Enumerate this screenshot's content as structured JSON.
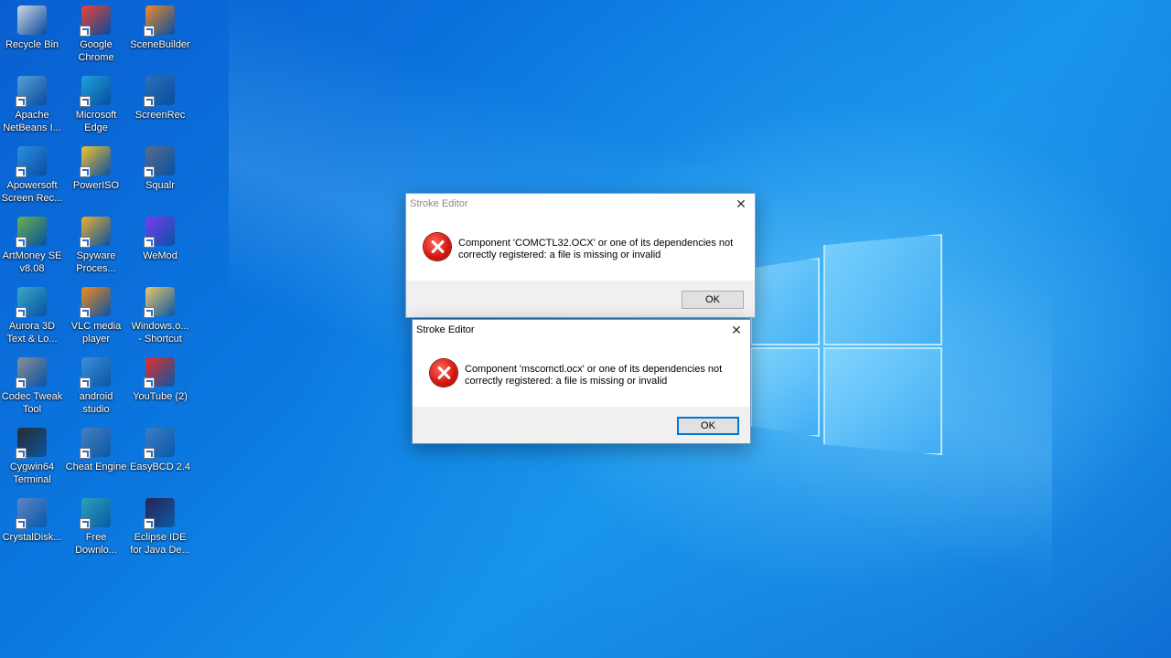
{
  "desktop": {
    "icons": [
      {
        "label": "Recycle Bin",
        "icon": "recycle-bin-icon",
        "color": "#cfd8e3"
      },
      {
        "label": "Google\nChrome",
        "icon": "chrome-icon",
        "color": "#ea4335"
      },
      {
        "label": "SceneBuilder",
        "icon": "scenebuilder-icon",
        "color": "#f08a2b"
      },
      {
        "label": "Apache\nNetBeans I...",
        "icon": "netbeans-icon",
        "color": "#5aa0d8"
      },
      {
        "label": "Microsoft\nEdge",
        "icon": "edge-icon",
        "color": "#1fa1d8"
      },
      {
        "label": "ScreenRec",
        "icon": "screenrec-icon",
        "color": "#2d6fb8"
      },
      {
        "label": "Apowersoft\nScreen Rec...",
        "icon": "apowersoft-icon",
        "color": "#2d8fe0"
      },
      {
        "label": "PowerISO",
        "icon": "poweriso-icon",
        "color": "#f2c230"
      },
      {
        "label": "Squalr",
        "icon": "squalr-icon",
        "color": "#5a6c8c"
      },
      {
        "label": "ArtMoney SE\nv8.08",
        "icon": "artmoney-icon",
        "color": "#6ab04c"
      },
      {
        "label": "Spyware\nProces...",
        "icon": "spyware-icon",
        "color": "#e8b030"
      },
      {
        "label": "WeMod",
        "icon": "wemod-icon",
        "color": "#7a3cf0"
      },
      {
        "label": "Aurora 3D\nText & Lo...",
        "icon": "aurora3d-icon",
        "color": "#3aa8c8"
      },
      {
        "label": "VLC media\nplayer",
        "icon": "vlc-icon",
        "color": "#f28b1c"
      },
      {
        "label": "Windows.o...\n- Shortcut",
        "icon": "folder-icon",
        "color": "#e8c86a"
      },
      {
        "label": "Codec Tweak\nTool",
        "icon": "codec-tweak-icon",
        "color": "#8a8f96"
      },
      {
        "label": "android\nstudio",
        "icon": "android-studio-icon",
        "color": "#3f8fd8"
      },
      {
        "label": "YouTube (2)",
        "icon": "youtube-icon",
        "color": "#e52d27"
      },
      {
        "label": "Cygwin64\nTerminal",
        "icon": "cygwin-icon",
        "color": "#2b2b2b"
      },
      {
        "label": "Cheat Engine",
        "icon": "cheat-engine-icon",
        "color": "#4a7fbf"
      },
      {
        "label": "EasyBCD 2.4",
        "icon": "easybcd-icon",
        "color": "#3c7dc4"
      },
      {
        "label": "CrystalDisk...",
        "icon": "crystaldisk-icon",
        "color": "#5d86c9"
      },
      {
        "label": "Free\nDownlo...",
        "icon": "free-download-icon",
        "color": "#2ba3b8"
      },
      {
        "label": "Eclipse IDE\nfor Java De...",
        "icon": "eclipse-icon",
        "color": "#2c2255"
      }
    ]
  },
  "dialogs": [
    {
      "title": "Stroke Editor",
      "message": "Component 'COMCTL32.OCX' or one of its dependencies not correctly registered: a file is missing or invalid",
      "ok_label": "OK"
    },
    {
      "title": "Stroke Editor",
      "message": "Component 'mscomctl.ocx' or one of its dependencies not correctly registered: a file is missing or invalid",
      "ok_label": "OK"
    }
  ],
  "colors": {
    "error_red": "#d2160f",
    "focus_blue": "#0078d7"
  }
}
